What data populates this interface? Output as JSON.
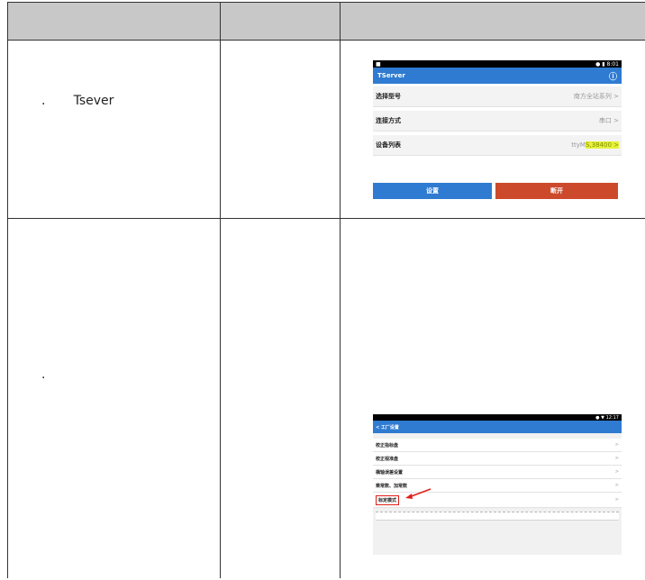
{
  "row1": {
    "col1_text": ".       Tsever",
    "screen": {
      "status_time": "8:01",
      "app_title": "TServer",
      "settings": [
        {
          "label": "选择型号",
          "value": "南方全站系列 >"
        },
        {
          "label": "连接方式",
          "value": "串口 >"
        },
        {
          "label": "设备列表",
          "value_prefix": "ttyM",
          "value_highlight": "S,38400 >"
        }
      ],
      "buttons": {
        "left": "设置",
        "right": "断开"
      },
      "colors": {
        "appbar": "#2f7bd1",
        "left_button": "#2f7bd1",
        "right_button": "#cc4a2b"
      }
    }
  },
  "row2": {
    "col1_text": ".",
    "screen": {
      "status_time": "12:17",
      "app_title": "< 工厂设置",
      "items": [
        {
          "label": "校正指标盘",
          "arrow": ">"
        },
        {
          "label": "校正视准盘",
          "arrow": ">"
        },
        {
          "label": "横轴误差设置",
          "arrow": ">"
        },
        {
          "label": "乘常数、加常数",
          "arrow": ">"
        },
        {
          "label": "标定模式",
          "arrow": ">"
        }
      ],
      "annotation_arrow_color": "#e0201b"
    }
  }
}
